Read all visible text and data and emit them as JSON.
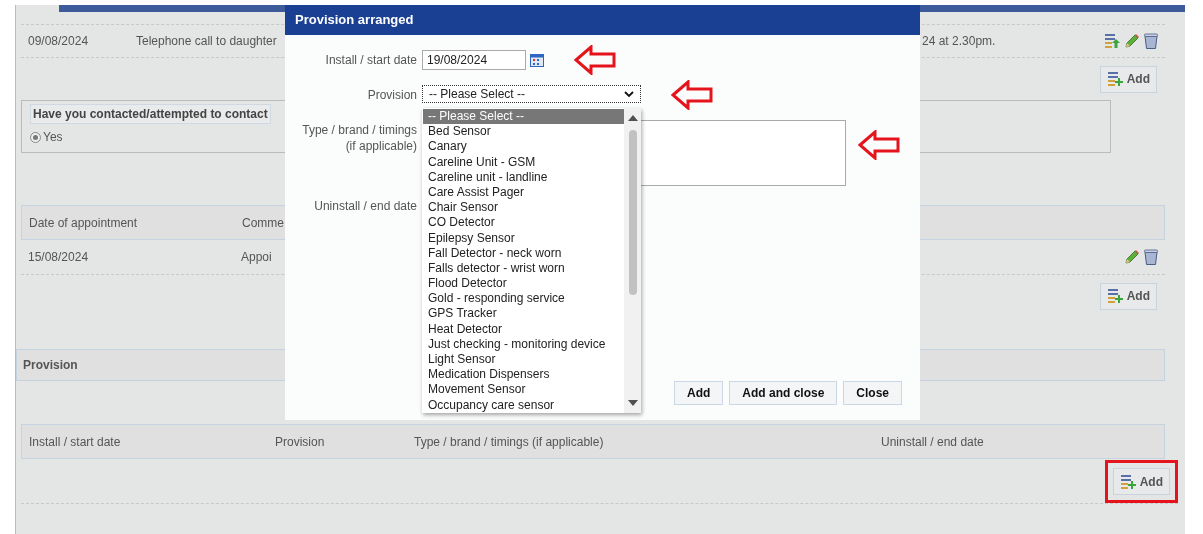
{
  "page": {
    "notes": {
      "rows": [
        {
          "cells": [
            "09/08/2024",
            "Telephone call to daughter"
          ],
          "trailing_text": "24 at 2.30pm.",
          "actions": [
            {
              "kind": "move"
            },
            {
              "kind": "edit"
            },
            {
              "kind": "delete"
            }
          ]
        }
      ],
      "add_button": {
        "label": "Add",
        "highlighted": false
      }
    },
    "contact_question": {
      "legend": "Have you contacted/attempted to contact",
      "options": [
        {
          "label": "Yes",
          "selected": true
        }
      ]
    },
    "appointments": {
      "columns": [
        "Date of appointment",
        "Comme"
      ],
      "rows": [
        {
          "cells": [
            "15/08/2024",
            "Appoi"
          ],
          "actions": [
            {
              "kind": "edit"
            },
            {
              "kind": "delete"
            }
          ]
        }
      ],
      "add_button": {
        "label": "Add",
        "highlighted": false
      }
    },
    "provision_section": {
      "title": "Provision"
    },
    "provision_table": {
      "columns": [
        "Install / start date",
        "Provision",
        "Type / brand / timings (if applicable)",
        "Uninstall / end date"
      ],
      "add_button": {
        "label": "Add",
        "highlighted": true
      }
    }
  },
  "dialog": {
    "title": "Provision arranged",
    "fields": [
      {
        "kind": "date",
        "label": "Install / start date",
        "value": "19/08/2024",
        "annotated": true
      },
      {
        "kind": "select",
        "label": "Provision",
        "value": "-- Please Select --",
        "annotated": true,
        "expanded": true,
        "options": [
          {
            "label": "-- Please Select --",
            "selected": true
          },
          {
            "label": "Bed Sensor",
            "selected": false
          },
          {
            "label": "Canary",
            "selected": false
          },
          {
            "label": "Careline Unit - GSM",
            "selected": false
          },
          {
            "label": "Careline unit - landline",
            "selected": false
          },
          {
            "label": "Care Assist Pager",
            "selected": false
          },
          {
            "label": "Chair Sensor",
            "selected": false
          },
          {
            "label": "CO Detector",
            "selected": false
          },
          {
            "label": "Epilepsy Sensor",
            "selected": false
          },
          {
            "label": "Fall Detector - neck worn",
            "selected": false
          },
          {
            "label": "Falls detector - wrist worn",
            "selected": false
          },
          {
            "label": "Flood Detector",
            "selected": false
          },
          {
            "label": "Gold - responding service",
            "selected": false
          },
          {
            "label": "GPS Tracker",
            "selected": false
          },
          {
            "label": "Heat Detector",
            "selected": false
          },
          {
            "label": "Just checking - monitoring device",
            "selected": false
          },
          {
            "label": "Light Sensor",
            "selected": false
          },
          {
            "label": "Medication Dispensers",
            "selected": false
          },
          {
            "label": "Movement Sensor",
            "selected": false
          },
          {
            "label": "Occupancy care sensor",
            "selected": false
          }
        ]
      },
      {
        "kind": "textarea",
        "label": "Type / brand / timings (if applicable)",
        "annotated": true
      },
      {
        "kind": "covered",
        "label": "Uninstall / end date",
        "annotated": false
      }
    ],
    "buttons": [
      "Add",
      "Add and close",
      "Close"
    ]
  }
}
